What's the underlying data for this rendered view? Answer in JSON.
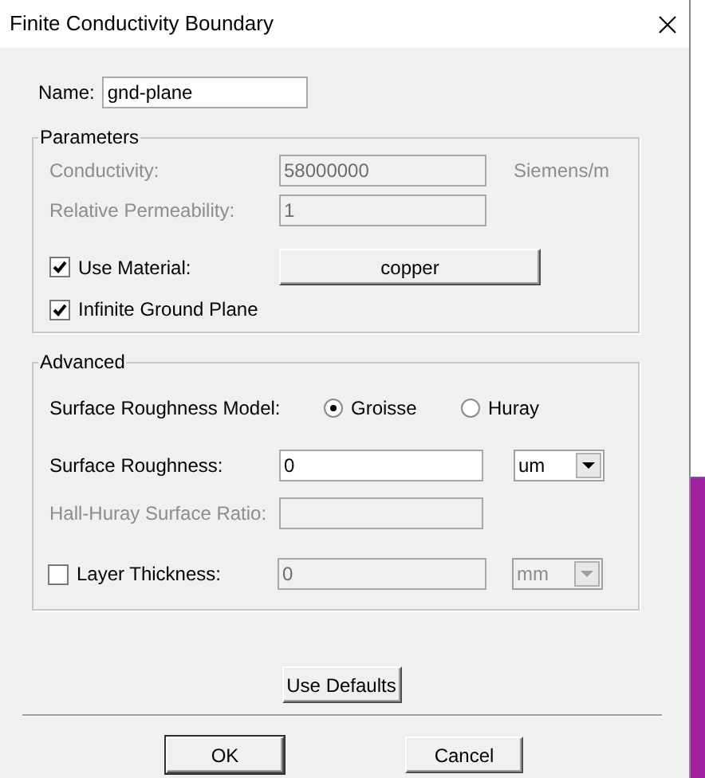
{
  "window": {
    "title": "Finite Conductivity Boundary"
  },
  "name_field": {
    "label": "Name:",
    "value": "gnd-plane"
  },
  "parameters": {
    "title": "Parameters",
    "conductivity": {
      "label": "Conductivity:",
      "value": "58000000",
      "unit": "Siemens/m",
      "disabled": true
    },
    "relative_permeability": {
      "label": "Relative Permeability:",
      "value": "1",
      "disabled": true
    },
    "use_material": {
      "label": "Use Material:",
      "checked": true,
      "button": "copper"
    },
    "infinite_ground_plane": {
      "label": "Infinite Ground Plane",
      "checked": true
    }
  },
  "advanced": {
    "title": "Advanced",
    "roughness_model": {
      "label": "Surface Roughness Model:",
      "options": [
        {
          "label": "Groisse",
          "selected": true
        },
        {
          "label": "Huray",
          "selected": false
        }
      ]
    },
    "surface_roughness": {
      "label": "Surface Roughness:",
      "value": "0",
      "unit": "um",
      "disabled": false
    },
    "hall_huray_ratio": {
      "label": "Hall-Huray Surface Ratio:",
      "disabled": true
    },
    "layer_thickness": {
      "label": "Layer Thickness:",
      "checked": false,
      "value": "0",
      "unit": "mm",
      "disabled": true
    }
  },
  "buttons": {
    "use_defaults": "Use Defaults",
    "ok": "OK",
    "cancel": "Cancel"
  }
}
